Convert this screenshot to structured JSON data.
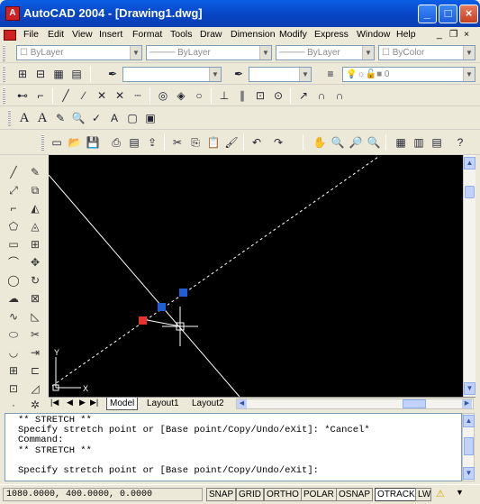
{
  "window": {
    "title": "AutoCAD 2004 - [Drawing1.dwg]",
    "min_label": "_",
    "max_label": "□",
    "close_label": "×"
  },
  "menu": [
    "File",
    "Edit",
    "View",
    "Insert",
    "Format",
    "Tools",
    "Draw",
    "Dimension",
    "Modify",
    "Express",
    "Window",
    "Help"
  ],
  "properties": {
    "layer": "0",
    "linetype1": "ByLayer",
    "linetype2": "ByLayer",
    "color": "ByColor"
  },
  "layout_tabs": [
    "Model",
    "Layout1",
    "Layout2"
  ],
  "ucs": {
    "y_label": "Y",
    "x_label": "X"
  },
  "command_lines": [
    "** STRETCH **",
    "Specify stretch point or [Base point/Copy/Undo/eXit]: *Cancel*",
    "Command:",
    "** STRETCH **",
    "",
    "Specify stretch point or [Base point/Copy/Undo/eXit]:"
  ],
  "status": {
    "coords": "1080.0000, 400.0000, 0.0000",
    "toggles": [
      {
        "label": "SNAP",
        "on": false
      },
      {
        "label": "GRID",
        "on": false
      },
      {
        "label": "ORTHO",
        "on": false
      },
      {
        "label": "POLAR",
        "on": false
      },
      {
        "label": "OSNAP",
        "on": false
      },
      {
        "label": "OTRACK",
        "on": true
      },
      {
        "label": "LWT",
        "on": false
      }
    ]
  },
  "colors": {
    "grip_selected": "#e8322b",
    "grip_unselected": "#1f5fd6",
    "canvas": "#000000"
  }
}
